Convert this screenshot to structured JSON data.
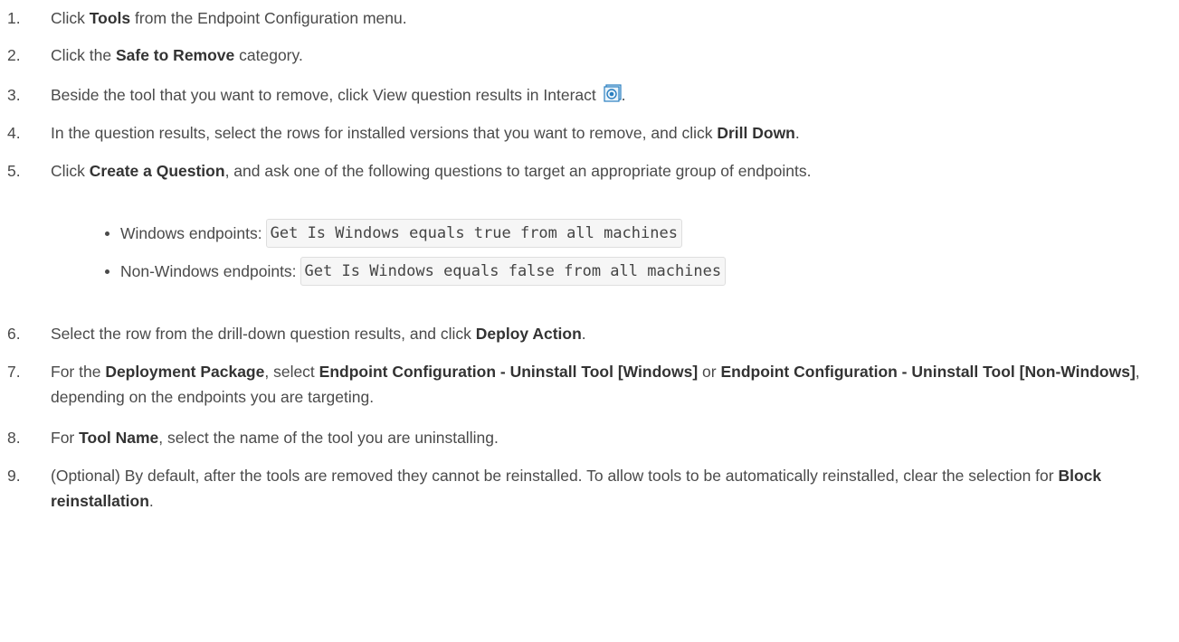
{
  "steps": [
    {
      "num": "1.",
      "parts": [
        [
          "t",
          "Click "
        ],
        [
          "b",
          "Tools"
        ],
        [
          "t",
          " from the Endpoint Configuration menu."
        ]
      ]
    },
    {
      "num": "2.",
      "parts": [
        [
          "t",
          "Click the "
        ],
        [
          "b",
          "Safe to Remove"
        ],
        [
          "t",
          " category."
        ]
      ]
    },
    {
      "num": "3.",
      "parts": [
        [
          "t",
          "Beside the tool that you want to remove, click View question results in Interact "
        ],
        [
          "icon",
          "interact-icon"
        ],
        [
          "t",
          "."
        ]
      ]
    },
    {
      "num": "4.",
      "parts": [
        [
          "t",
          "In the question results, select the rows for installed versions that you want to remove, and click "
        ],
        [
          "b",
          "Drill Down"
        ],
        [
          "t",
          "."
        ]
      ]
    },
    {
      "num": "5.",
      "parts": [
        [
          "t",
          "Click "
        ],
        [
          "b",
          "Create a Question"
        ],
        [
          "t",
          ", and ask one of the following questions to target an appropriate group of endpoints."
        ]
      ]
    },
    {
      "num": "6.",
      "parts": [
        [
          "t",
          "Select the row from the drill-down question results, and click "
        ],
        [
          "b",
          "Deploy Action"
        ],
        [
          "t",
          "."
        ]
      ]
    },
    {
      "num": "7.",
      "parts": [
        [
          "t",
          "For the "
        ],
        [
          "b",
          "Deployment Package"
        ],
        [
          "t",
          ", select "
        ],
        [
          "b",
          "Endpoint Configuration - Uninstall Tool [Windows]"
        ],
        [
          "t",
          " or "
        ],
        [
          "b",
          "Endpoint Configuration - Uninstall Tool [Non-Windows]"
        ],
        [
          "t",
          ", depending on the endpoints you are targeting."
        ]
      ]
    },
    {
      "num": "8.",
      "parts": [
        [
          "t",
          "For "
        ],
        [
          "b",
          "Tool Name"
        ],
        [
          "t",
          ", select the name of the tool you are uninstalling."
        ]
      ]
    },
    {
      "num": "9.",
      "parts": [
        [
          "t",
          "(Optional) By default, after the tools are removed they cannot be reinstalled. To allow tools to be automatically reinstalled, clear the selection for "
        ],
        [
          "b",
          "Block reinstallation"
        ],
        [
          "t",
          "."
        ]
      ]
    }
  ],
  "bullets": [
    {
      "label": "Windows endpoints:",
      "code": "Get Is Windows equals true from all machines"
    },
    {
      "label": "Non-Windows endpoints:",
      "code": "Get Is Windows equals false from all machines"
    }
  ]
}
